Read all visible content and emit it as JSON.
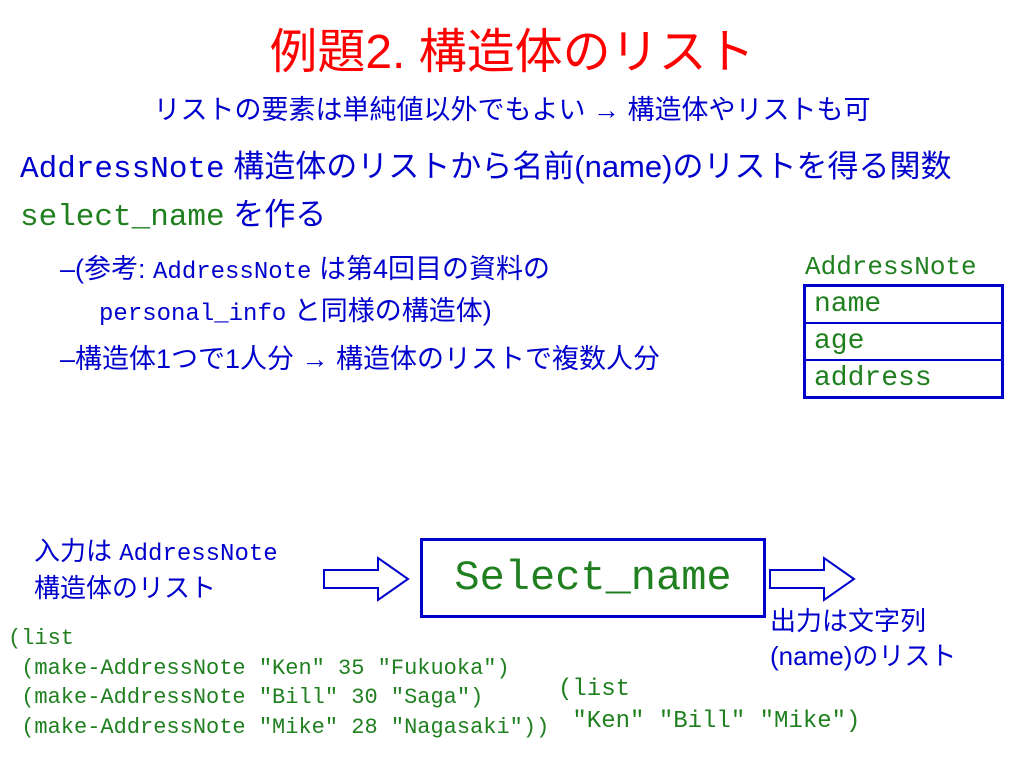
{
  "title": "例題2. 構造体のリスト",
  "subtitle": "リストの要素は単純値以外でもよい → 構造体やリストも可",
  "main": {
    "pre": "AddressNote",
    "mid1": " 構造体のリストから名前(name)のリストを得る関数 ",
    "func": "select_name",
    "mid2": " を作る"
  },
  "bullets": {
    "b1a": "–(参考: ",
    "b1b": "AddressNote",
    "b1c": " は第4回目の資料の",
    "b1d": "personal_info",
    "b1e": " と同様の構造体)",
    "b2": "–構造体1つで1人分 → 構造体のリストで複数人分"
  },
  "struct": {
    "label": "AddressNote",
    "rows": [
      "name",
      "age",
      "address"
    ]
  },
  "flow": {
    "input_label_l1": "入力は ",
    "input_label_mono": "AddressNote",
    "input_label_l2": "構造体のリスト",
    "func_box": "Select_name",
    "output_label_l1": "出力は文字列",
    "output_label_l2": "(name)のリスト",
    "code_in": "(list\n (make-AddressNote \"Ken\" 35 \"Fukuoka\")\n (make-AddressNote \"Bill\" 30 \"Saga\")\n (make-AddressNote \"Mike\" 28 \"Nagasaki\"))",
    "code_out": "(list\n \"Ken\" \"Bill\" \"Mike\")"
  }
}
